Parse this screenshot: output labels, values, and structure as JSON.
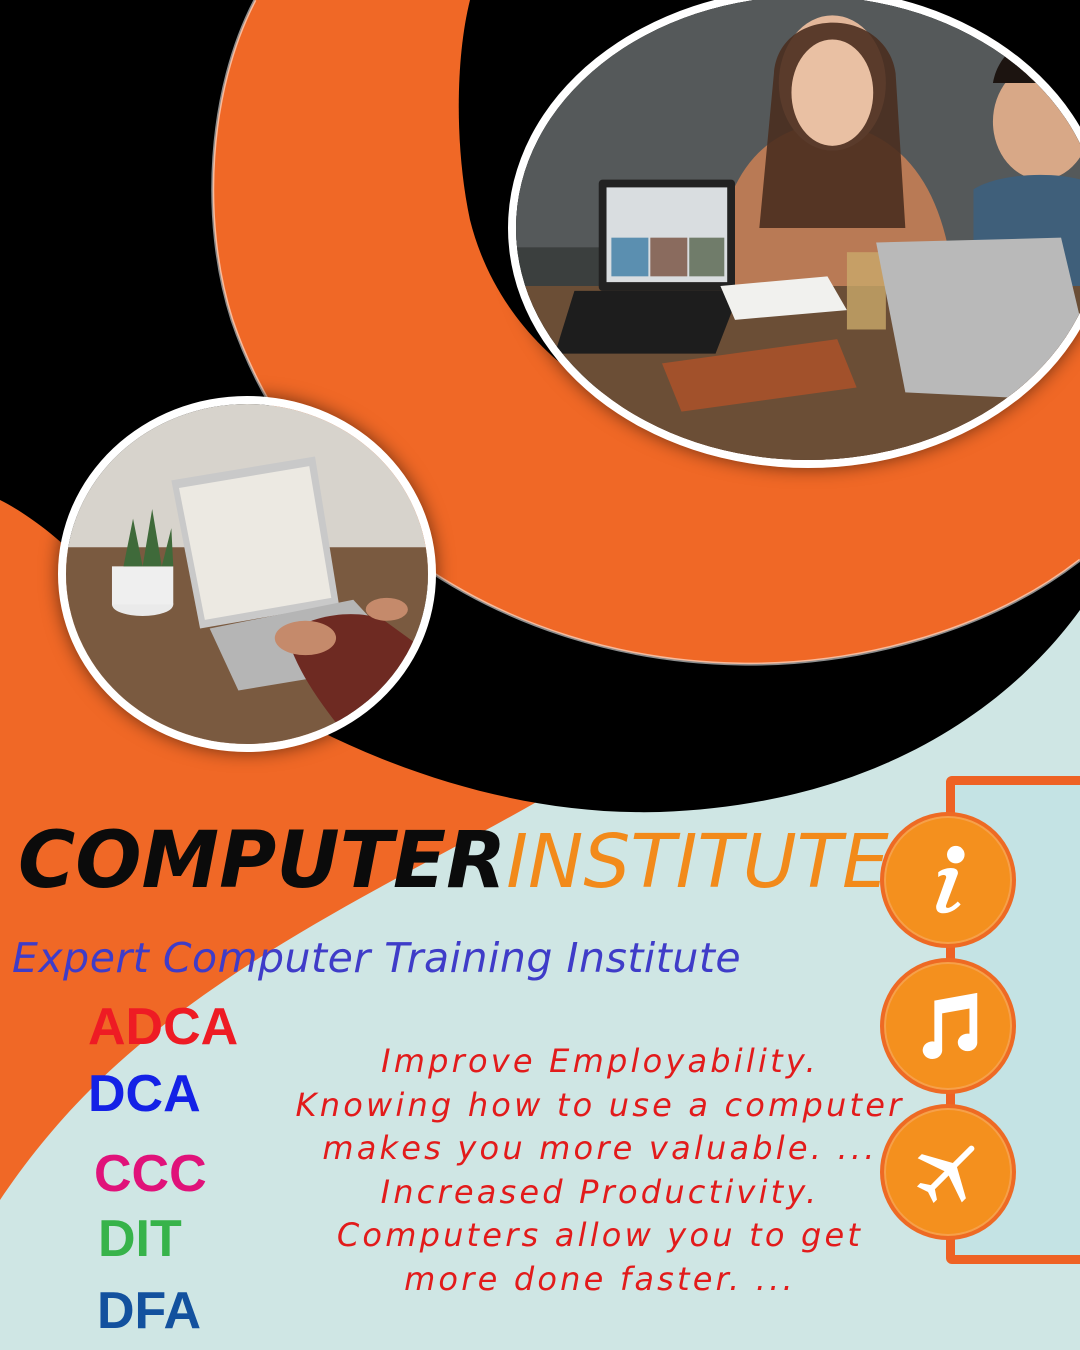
{
  "colors": {
    "background": "#cfe6e4",
    "orange": "#f06826",
    "black": "#000000",
    "title_dark": "#0b0b0b",
    "title_orange": "#f28a1a",
    "subtitle": "#3f3cc8",
    "blurb": "#e21b1b",
    "icon_fill": "#f4901e"
  },
  "title": {
    "part1": "COMPUTER",
    "part2": "INSTITUTE"
  },
  "subtitle": "Expert Computer Training Institute",
  "courses": [
    {
      "label": "ADCA",
      "color": "#ee1b24"
    },
    {
      "label": "DCA",
      "color": "#1421e6"
    },
    {
      "label": "CCC",
      "color": "#e0127a"
    },
    {
      "label": "DIT",
      "color": "#37b34a"
    },
    {
      "label": "DFA",
      "color": "#13519e"
    }
  ],
  "blurb": [
    "Improve Employability.",
    "Knowing how to use a computer",
    "makes you more valuable. ...",
    "Increased Productivity.",
    "Computers allow you to get",
    "more done faster. ..."
  ],
  "photos": {
    "main": {
      "subject": "two people laughing at laptops"
    },
    "small": {
      "subject": "hands typing on laptop with potted plant"
    }
  },
  "icons": [
    "info-icon",
    "music-note-icon",
    "airplane-icon"
  ]
}
